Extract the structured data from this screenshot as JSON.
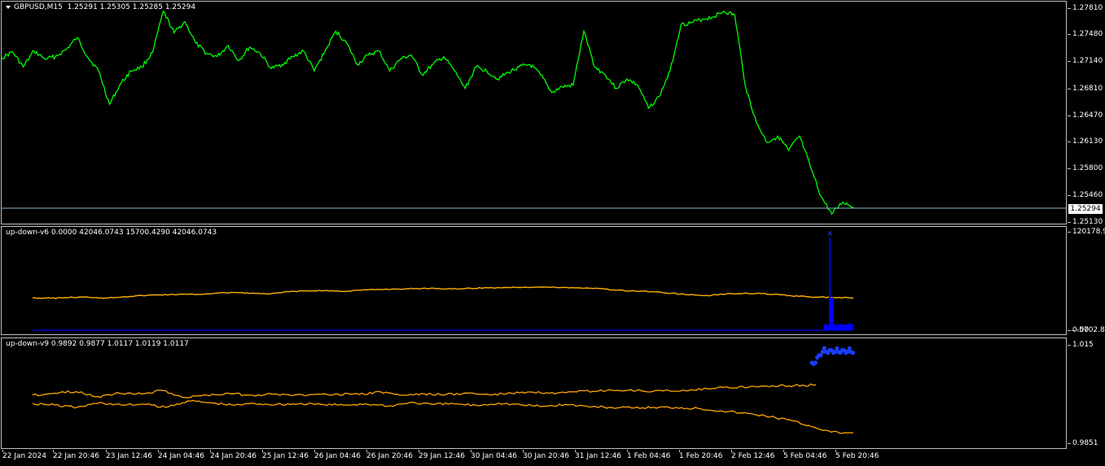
{
  "main_pane": {
    "symbol_info": "GBPUSD,M15  1.25291 1.25305 1.25285 1.25294",
    "current_price": "1.25294",
    "price_ticks": [
      "1.27810",
      "1.27480",
      "1.27140",
      "1.26810",
      "1.26470",
      "1.26130",
      "1.25800",
      "1.25460",
      "1.25130"
    ],
    "line_color": "#00ff00",
    "price_line_color": "#8cb4c8"
  },
  "indicator_v6": {
    "info": "up-down-v6 0.0000 42046.0743 15700.4290 42046.0743",
    "scale_top": "120178.93",
    "scale_bottom": "-5702.806",
    "scale_bottom_overlap": "0.00",
    "colors": {
      "line": "#ffb000",
      "bars": "#0000ff"
    }
  },
  "indicator_v9": {
    "info": "up-down-v9 0.9892 0.9877 1.0117 1.0119 1.0117",
    "scale_top": "1.015",
    "scale_bottom": "0.9851",
    "colors": {
      "lines": "#ffa500",
      "markers": "#1a3cff"
    }
  },
  "time_axis": {
    "labels": [
      "22 Jan 2024",
      "22 Jan 20:46",
      "23 Jan 12:46",
      "24 Jan 04:46",
      "24 Jan 20:46",
      "25 Jan 12:46",
      "26 Jan 04:46",
      "26 Jan 20:46",
      "29 Jan 12:46",
      "30 Jan 04:46",
      "30 Jan 20:46",
      "31 Jan 12:46",
      "1 Feb 04:46",
      "1 Feb 20:46",
      "2 Feb 12:46",
      "5 Feb 04:46",
      "5 Feb 20:46"
    ]
  },
  "chart_data": [
    {
      "type": "line",
      "title": "GBPUSD,M15",
      "series": [
        {
          "name": "GBPUSD",
          "values": [
            1.2716,
            1.2724,
            1.2705,
            1.2725,
            1.2715,
            1.2718,
            1.2727,
            1.2742,
            1.2717,
            1.27,
            1.2658,
            1.2683,
            1.27,
            1.2705,
            1.2723,
            1.2775,
            1.2748,
            1.2762,
            1.2735,
            1.2722,
            1.2718,
            1.2732,
            1.2713,
            1.273,
            1.2722,
            1.2703,
            1.2708,
            1.2718,
            1.2725,
            1.27,
            1.2725,
            1.275,
            1.2735,
            1.2708,
            1.272,
            1.2725,
            1.27,
            1.2715,
            1.272,
            1.2695,
            1.2708,
            1.2718,
            1.27,
            1.2678,
            1.2705,
            1.27,
            1.269,
            1.2698,
            1.2705,
            1.2708,
            1.2695,
            1.2673,
            1.268,
            1.2682,
            1.275,
            1.2705,
            1.2695,
            1.2678,
            1.269,
            1.2682,
            1.2653,
            1.2668,
            1.27,
            1.2758,
            1.2761,
            1.2765,
            1.2768,
            1.2775,
            1.277,
            1.268,
            1.2635,
            1.261,
            1.2618,
            1.26,
            1.2618,
            1.258,
            1.2542,
            1.252,
            1.2535,
            1.2529
          ]
        }
      ],
      "ylim": [
        1.2513,
        1.2781
      ]
    },
    {
      "type": "line",
      "title": "up-down-v6",
      "series": [
        {
          "name": "line",
          "values": [
            42000,
            41500,
            42500,
            43000,
            41800,
            43500,
            45000,
            46000,
            46500,
            46500,
            48000,
            49000,
            48000,
            47000,
            50000,
            51000,
            51500,
            50500,
            52000,
            53000,
            53500,
            54000,
            54500,
            53500,
            54500,
            55000,
            55500,
            56000,
            56000,
            55500,
            55000,
            54500,
            52000,
            51000,
            50000,
            48000,
            46000,
            45000,
            47000,
            48000,
            47500,
            46000,
            44000,
            43000,
            42500,
            42000,
            42046
          ]
        },
        {
          "name": "bars",
          "values": [
            0,
            0,
            0,
            0,
            0,
            0,
            0,
            0,
            0,
            0,
            0,
            0,
            0,
            0,
            0,
            0,
            0,
            0,
            0,
            0,
            0,
            0,
            0,
            0,
            0,
            0,
            0,
            0,
            0,
            0,
            0,
            0,
            0,
            0,
            0,
            0,
            0,
            0,
            0,
            0,
            0,
            0,
            0,
            120000,
            42000,
            15700,
            0
          ]
        }
      ],
      "ylim": [
        -5702.806,
        120178.93
      ]
    },
    {
      "type": "line",
      "title": "up-down-v9",
      "series": [
        {
          "name": "upper",
          "values": [
            0.9992,
            0.9998,
            1.0003,
            0.9988,
            0.9998,
            0.9996,
            1.0006,
            0.9985,
            0.9992,
            0.9998,
            0.9992,
            0.9995,
            0.9992,
            0.9994,
            0.9996,
            0.9994,
            1.0002,
            0.9992,
            0.9996,
            0.9994,
            0.9998,
            0.9993,
            0.9998,
            1.0001,
            0.9996,
            1.0002,
            1.0005,
            1.0006,
            1.0005,
            1.0005,
            1.0006,
            1.0012,
            1.0015,
            1.0018,
            1.0021,
            1.0021,
            1.0023,
            1.0117
          ]
        },
        {
          "name": "lower",
          "values": [
            0.9967,
            0.9962,
            0.9955,
            0.9969,
            0.9962,
            0.9965,
            0.9955,
            0.9975,
            0.9969,
            0.9962,
            0.9967,
            0.9964,
            0.9966,
            0.9964,
            0.9962,
            0.9966,
            0.9958,
            0.997,
            0.9964,
            0.9966,
            0.9961,
            0.9968,
            0.9963,
            0.9958,
            0.9964,
            0.9958,
            0.9955,
            0.9953,
            0.9955,
            0.9955,
            0.9952,
            0.9945,
            0.9938,
            0.993,
            0.9918,
            0.99,
            0.988,
            0.9877
          ]
        }
      ],
      "ylim": [
        0.9851,
        1.015
      ]
    }
  ]
}
